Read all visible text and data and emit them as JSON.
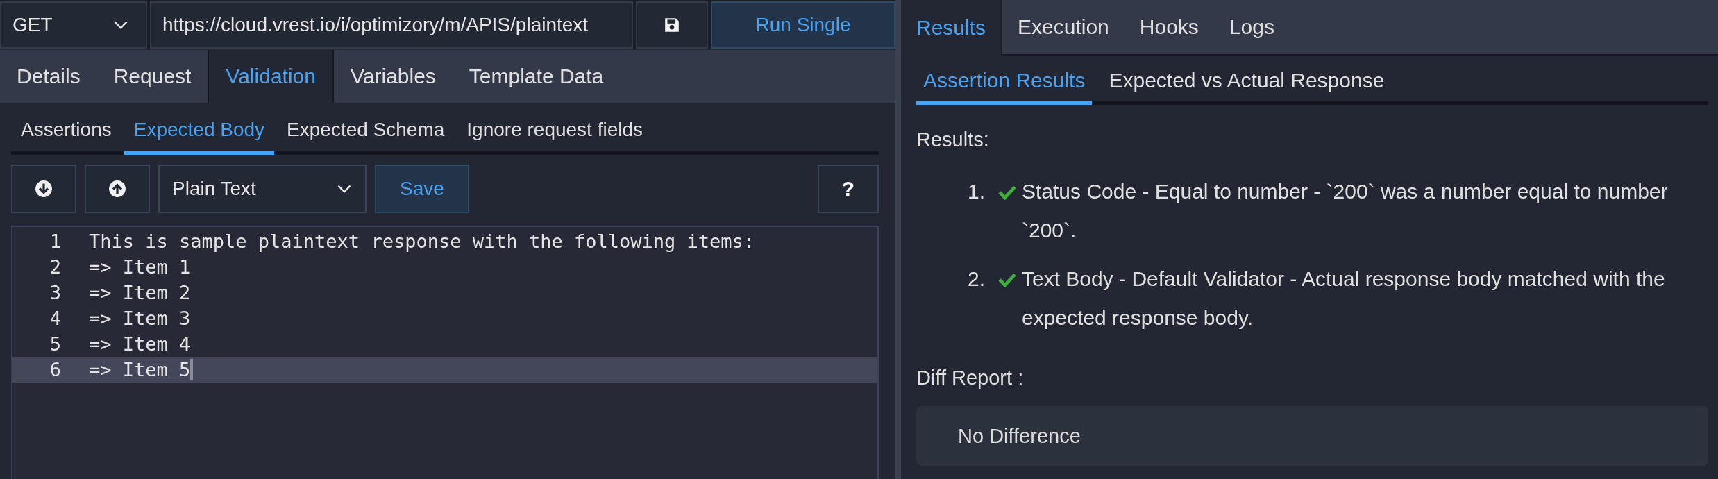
{
  "request_bar": {
    "method": "GET",
    "url": "https://cloud.vrest.io/i/optimizory/m/APIS/plaintext",
    "run_button": "Run Single"
  },
  "tabs": [
    {
      "label": "Details",
      "selected": false
    },
    {
      "label": "Request",
      "selected": false
    },
    {
      "label": "Validation",
      "selected": true
    },
    {
      "label": "Variables",
      "selected": false
    },
    {
      "label": "Template Data",
      "selected": false
    }
  ],
  "validation_tabs": [
    {
      "label": "Assertions",
      "selected": false
    },
    {
      "label": "Expected Body",
      "selected": true
    },
    {
      "label": "Expected Schema",
      "selected": false
    },
    {
      "label": "Ignore request fields",
      "selected": false
    }
  ],
  "toolbar": {
    "format": "Plain Text",
    "save_button": "Save",
    "help_button": "?"
  },
  "editor": {
    "lines": [
      {
        "number": "1",
        "text": "This is sample plaintext response with the following items:",
        "active": false
      },
      {
        "number": "2",
        "text": "=> Item 1",
        "active": false
      },
      {
        "number": "3",
        "text": "=> Item 2",
        "active": false
      },
      {
        "number": "4",
        "text": "=> Item 3",
        "active": false
      },
      {
        "number": "5",
        "text": "=> Item 4",
        "active": false
      },
      {
        "number": "6",
        "text": "=> Item 5",
        "active": true
      }
    ]
  },
  "results_panel": {
    "tabs": [
      {
        "label": "Results",
        "selected": true
      },
      {
        "label": "Execution",
        "selected": false
      },
      {
        "label": "Hooks",
        "selected": false
      },
      {
        "label": "Logs",
        "selected": false
      }
    ],
    "sub_tabs": [
      {
        "label": "Assertion Results",
        "selected": true
      },
      {
        "label": "Expected vs Actual Response",
        "selected": false
      }
    ],
    "results_heading": "Results:",
    "results": [
      {
        "number": "1.",
        "passed": true,
        "text": "Status Code - Equal to number - `200` was a number equal to number `200`."
      },
      {
        "number": "2.",
        "passed": true,
        "text": "Text Body - Default Validator - Actual response body matched with the expected response body."
      }
    ],
    "diff_heading": "Diff Report :",
    "diff_text": "No Difference"
  }
}
